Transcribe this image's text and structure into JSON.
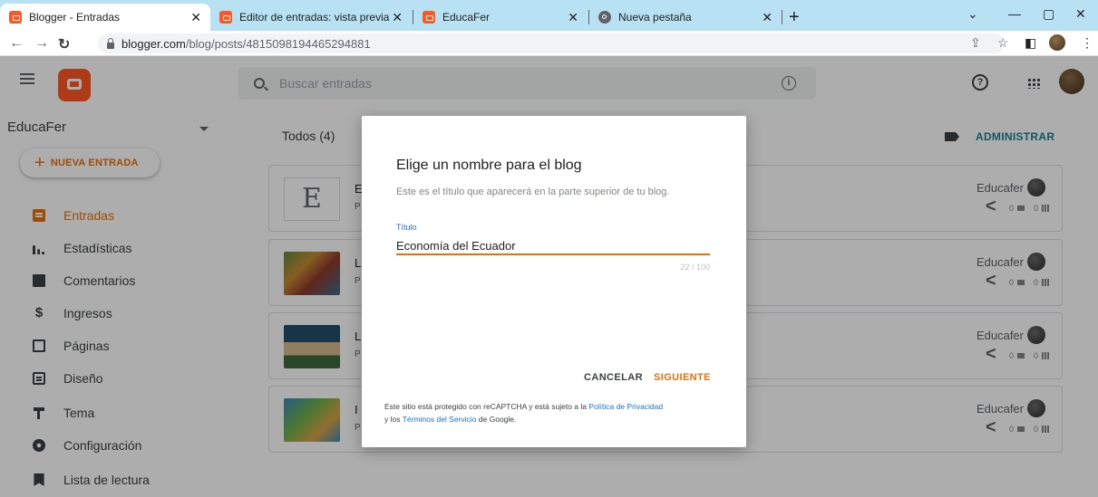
{
  "browser": {
    "tabs": [
      {
        "title": "Blogger - Entradas",
        "active": true
      },
      {
        "title": "Editor de entradas: vista previa",
        "active": false
      },
      {
        "title": "EducaFer",
        "active": false
      },
      {
        "title": "Nueva pestaña",
        "active": false
      }
    ],
    "url_host": "blogger.com",
    "url_path": "/blog/posts/4815098194465294881"
  },
  "header": {
    "search_placeholder": "Buscar entradas"
  },
  "sidebar": {
    "blog_name": "EducaFer",
    "new_post_label": "NUEVA ENTRADA",
    "items": [
      {
        "label": "Entradas",
        "icon": "posts-icon",
        "active": true
      },
      {
        "label": "Estadísticas",
        "icon": "stats-icon"
      },
      {
        "label": "Comentarios",
        "icon": "comments-icon"
      },
      {
        "label": "Ingresos",
        "icon": "dollar-icon"
      },
      {
        "label": "Páginas",
        "icon": "pages-icon"
      },
      {
        "label": "Diseño",
        "icon": "layout-icon"
      },
      {
        "label": "Tema",
        "icon": "theme-icon"
      },
      {
        "label": "Configuración",
        "icon": "gear-icon"
      },
      {
        "label": "Lista de lectura",
        "icon": "bookmark-icon"
      }
    ]
  },
  "main": {
    "filter_label": "Todos (4)",
    "manage_label": "ADMINISTRAR",
    "posts": [
      {
        "title_fragment": "E",
        "sub_fragment": "P",
        "thumb_letter": "E",
        "author": "Educafer",
        "comments": "0",
        "views": "0"
      },
      {
        "title_fragment": "L",
        "sub_fragment": "P",
        "author": "Educafer",
        "comments": "0",
        "views": "0"
      },
      {
        "title_fragment": "L",
        "sub_fragment": "P",
        "author": "Educafer",
        "comments": "0",
        "views": "0"
      },
      {
        "title_fragment": "I",
        "sub_fragment": "P",
        "author": "Educafer",
        "comments": "0",
        "views": "0"
      }
    ]
  },
  "dialog": {
    "title": "Elige un nombre para el blog",
    "description": "Este es el título que aparecerá en la parte superior de tu blog.",
    "field_label": "Título",
    "field_value": "Economía del Ecuador",
    "counter": "22 / 100",
    "cancel_label": "CANCELAR",
    "next_label": "SIGUIENTE",
    "recaptcha_prefix": "Este sitio está protegido con reCAPTCHA y está sujeto a la ",
    "privacy_link": "Política de Privacidad",
    "recaptcha_middle": "y los ",
    "terms_link": "Términos del Servicio",
    "recaptcha_suffix": " de Google."
  },
  "colors": {
    "accent": "#e8710a",
    "brand": "#ff5722",
    "link": "#1a73e8",
    "tabstrip": "#b8e2f4"
  }
}
